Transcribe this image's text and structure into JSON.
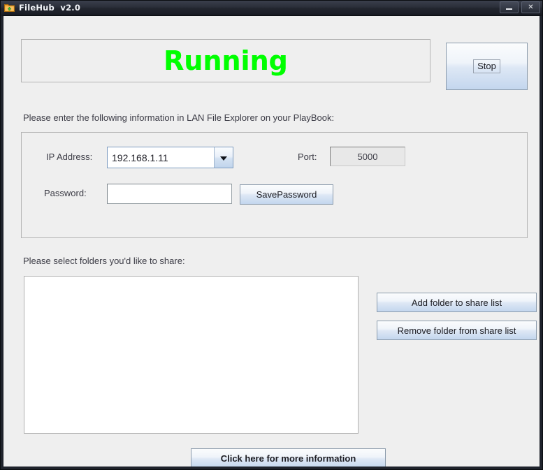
{
  "window": {
    "title": "FileHub  v2.0",
    "icon": "folder-upload-icon",
    "minimize_label": "",
    "close_label": "✕"
  },
  "status": {
    "text": "Running",
    "color": "#00ff00"
  },
  "toolbar": {
    "stop_label": "Stop"
  },
  "hints": {
    "connection": "Please enter the following information in LAN File Explorer on your PlayBook:",
    "folders": "Please select folders you'd like to share:"
  },
  "connection": {
    "ip_label": "IP Address:",
    "ip_value": "192.168.1.11",
    "ip_options": [
      "192.168.1.11"
    ],
    "port_label": "Port:",
    "port_value": "5000",
    "password_label": "Password:",
    "password_value": "",
    "password_placeholder": "",
    "save_password_label": "SavePassword"
  },
  "share": {
    "items": [],
    "add_label": "Add folder to share list",
    "remove_label": "Remove folder from share list"
  },
  "footer": {
    "more_info_label": "Click here for more information"
  },
  "colors": {
    "window_frame": "#1f232c",
    "client_bg": "#efefef",
    "status_green": "#00ff00",
    "button_accent": "#c3d6ee",
    "icon_folder": "#f0a029",
    "icon_arrow": "#3fbd3f"
  }
}
